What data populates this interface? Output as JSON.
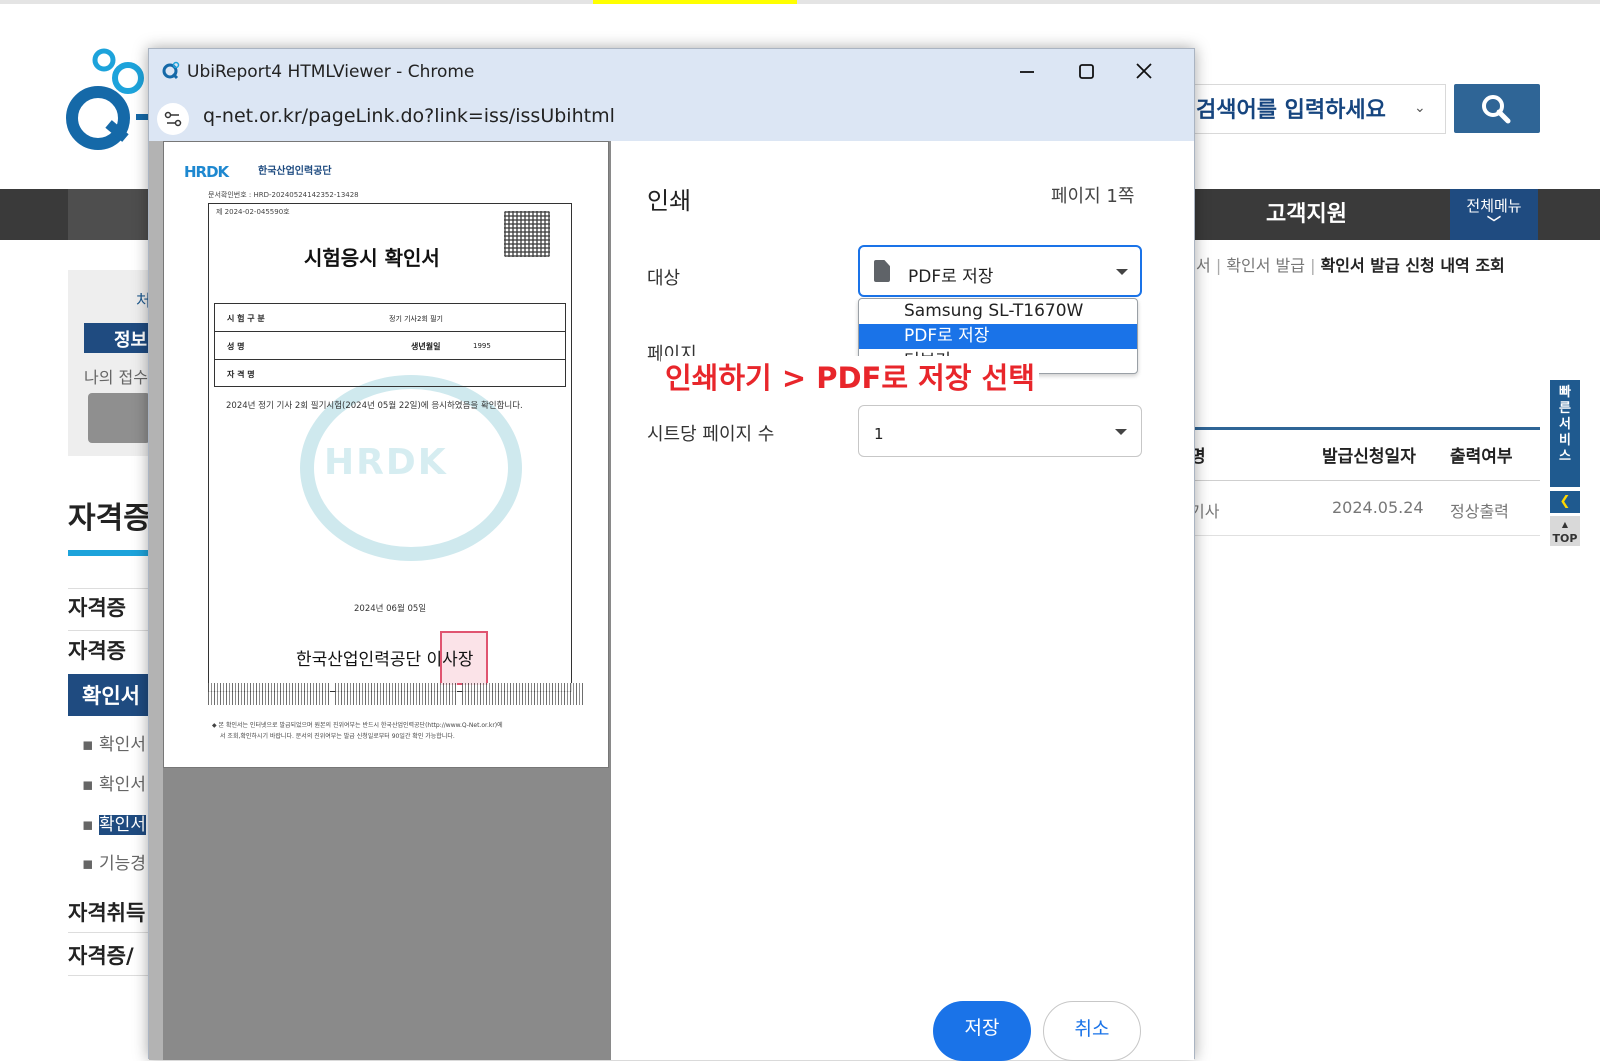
{
  "site": {
    "search_placeholder": "검색어를 입력하세요",
    "nav_support": "고객지원",
    "nav_allmenu": "전체메뉴",
    "breadcrumb": {
      "partial": "서",
      "item": "확인서 발급",
      "current": "확인서 발급 신청 내역 조회"
    },
    "table": {
      "headers": [
        "명",
        "발급신청일자",
        "출력여부"
      ],
      "rows": [
        [
          "기사",
          "2024.05.24",
          "정상출력"
        ]
      ]
    },
    "quick_service": "빠른서비스",
    "top_label": "TOP",
    "left": {
      "top_link": "처",
      "info_button": "정보",
      "small_text": "나의 접수",
      "title": "자격증",
      "menu": [
        "자격증 ",
        "자격증 ",
        "확인서",
        "자격취득",
        "자격증/"
      ],
      "sub": [
        "확인서",
        "확인서",
        "확인서",
        "기능경"
      ]
    },
    "colors": {
      "brand_blue": "#1f4b80",
      "accent_cyan": "#1da3db"
    }
  },
  "window": {
    "title": "UbiReport4 HTMLViewer - Chrome",
    "url": "q-net.or.kr/pageLink.do?link=iss/issUbihtml",
    "icons": [
      "q-net-favicon",
      "minimize-icon",
      "maximize-icon",
      "close-icon",
      "site-settings-icon"
    ]
  },
  "document": {
    "hrdk_logo": "HRDK",
    "org_name": "한국산업인력공단",
    "doc_number": "문서확인번호 : HRD-20240524142352-13428",
    "cert_number": "제  2024-02-045590호",
    "title": "시험응시 확인서",
    "rows": [
      {
        "label": "시 험 구 분",
        "value": "정기 기사2회 필기"
      },
      {
        "label": "성          명",
        "value": "",
        "label2": "생년월일",
        "value2": "1995"
      },
      {
        "label": "자   격   명",
        "value": ""
      }
    ],
    "statement": "2024년 정기 기사 2회 필기시험(2024년 05월 22일)에 응시하였음을 확인합니다.",
    "watermark": "HRDK",
    "issue_date": "2024년 06월 05일",
    "issuer": "한국산업인력공단 이사장",
    "footnote1": "◆ 본 확인서는 인터넷으로 발급되었으며 원본의 진위여부는 반드시 한국산업인력공단(http://www.Q-Net.or.kr)에",
    "footnote2": "서 조회,확인하시기 바랍니다.  문서의 진위여부는 발급 신청일로부터 90일간 확인 가능합니다."
  },
  "print": {
    "title": "인쇄",
    "page_count": "페이지 1쪽",
    "destination_label": "대상",
    "destination_value": "PDF로 저장",
    "destination_options": [
      "Samsung SL-T1670W Series",
      "PDF로 저장",
      "더보기..."
    ],
    "pages_label": "페이지",
    "pages_per_sheet_label": "시트당 페이지 수",
    "pages_per_sheet_value": "1",
    "annotation": "인쇄하기 > PDF로 저장 선택",
    "save_button": "저장",
    "cancel_button": "취소",
    "colors": {
      "accent": "#1a73e8",
      "annotation": "#e8262b"
    }
  }
}
